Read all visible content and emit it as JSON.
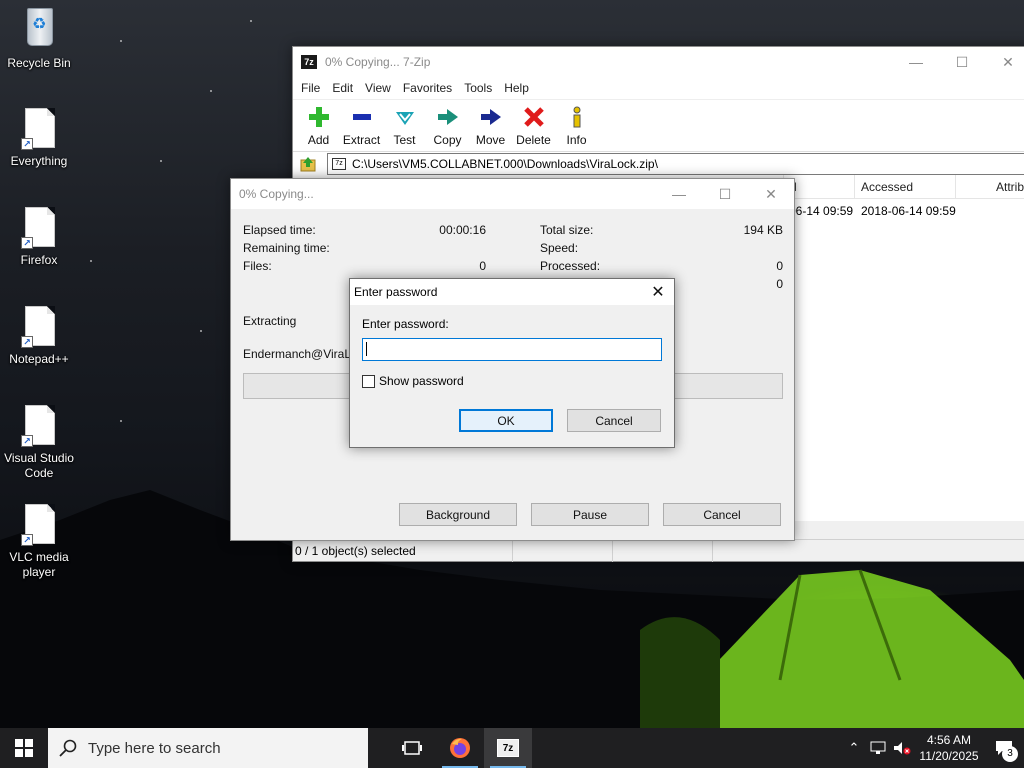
{
  "desktop": {
    "icons": [
      {
        "label": "Recycle Bin"
      },
      {
        "label": "Everything"
      },
      {
        "label": "Firefox"
      },
      {
        "label": "Notepad++"
      },
      {
        "label": "Visual Studio Code"
      },
      {
        "label": "VLC media player"
      }
    ]
  },
  "zip_window": {
    "title": "0% Copying... 7-Zip",
    "menu": [
      "File",
      "Edit",
      "View",
      "Favorites",
      "Tools",
      "Help"
    ],
    "toolbar": [
      {
        "label": "Add",
        "icon": "plus-icon",
        "color": "#2fb82f"
      },
      {
        "label": "Extract",
        "icon": "minus-icon",
        "color": "#1a2fb0"
      },
      {
        "label": "Test",
        "icon": "check-icon",
        "color": "#1aa3b5"
      },
      {
        "label": "Copy",
        "icon": "copy-arrow-icon",
        "color": "#1a8f7a"
      },
      {
        "label": "Move",
        "icon": "move-arrow-icon",
        "color": "#1a2a90"
      },
      {
        "label": "Delete",
        "icon": "delete-x-icon",
        "color": "#e01b1b"
      },
      {
        "label": "Info",
        "icon": "info-icon",
        "color": "#e6c200"
      }
    ],
    "address": "C:\\Users\\VM5.COLLABNET.000\\Downloads\\ViraLock.zip\\",
    "columns": [
      "d",
      "Accessed",
      "Attrib"
    ],
    "row": {
      "modified": "06-14 09:59",
      "accessed": "2018-06-14 09:59"
    },
    "status": "0 / 1 object(s) selected"
  },
  "progress_window": {
    "title": "0% Copying...",
    "elapsed_label": "Elapsed time:",
    "elapsed_value": "00:00:16",
    "remaining_label": "Remaining time:",
    "files_label": "Files:",
    "files_value": "0",
    "total_label": "Total size:",
    "total_value": "194 KB",
    "speed_label": "Speed:",
    "processed_label": "Processed:",
    "processed_value": "0",
    "extra_value": "0",
    "extracting_label": "Extracting",
    "current_file": "Endermanch@ViraLoc",
    "progress": 0,
    "buttons": {
      "background": "Background",
      "pause": "Pause",
      "cancel": "Cancel"
    }
  },
  "password_dialog": {
    "title": "Enter password",
    "label": "Enter password:",
    "value": "",
    "show_password": "Show password",
    "show_password_checked": false,
    "ok": "OK",
    "cancel": "Cancel"
  },
  "taskbar": {
    "search_placeholder": "Type here to search",
    "time": "4:56 AM",
    "date": "11/20/2025",
    "notifications": "3"
  }
}
